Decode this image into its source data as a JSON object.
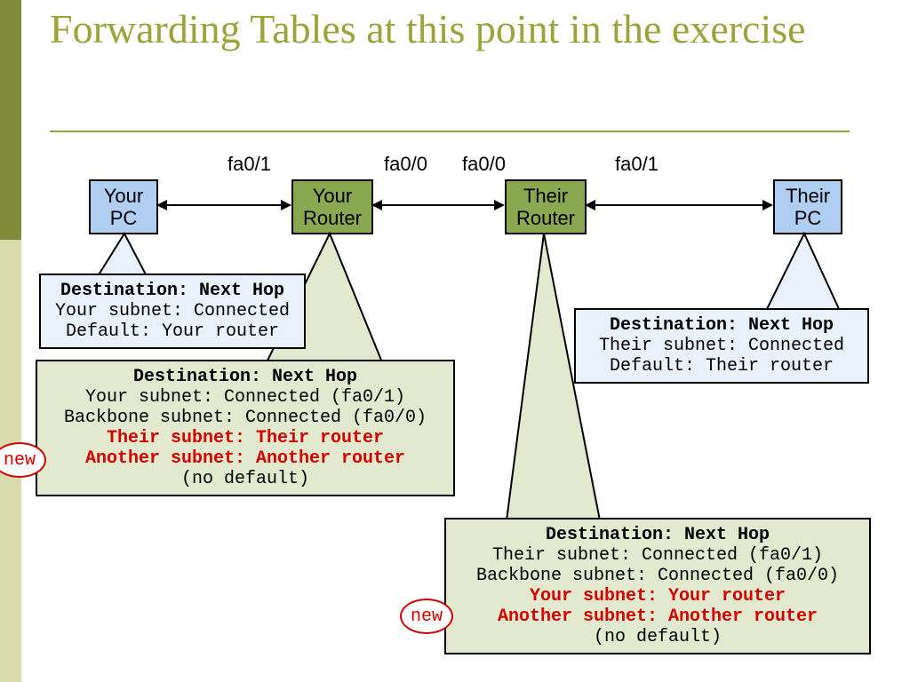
{
  "title": "Forwarding Tables at this point in the exercise",
  "iface": {
    "a": "fa0/1",
    "b": "fa0/0",
    "c": "fa0/0",
    "d": "fa0/1"
  },
  "nodes": {
    "yourpc": {
      "l1": "Your",
      "l2": "PC"
    },
    "yourrouter": {
      "l1": "Your",
      "l2": "Router"
    },
    "theirrouter": {
      "l1": "Their",
      "l2": "Router"
    },
    "theirpc": {
      "l1": "Their",
      "l2": "PC"
    }
  },
  "callouts": {
    "yourpc": {
      "head": "Destination: Next Hop",
      "r1": "Your subnet: Connected",
      "r2": "Default: Your router"
    },
    "theirpc": {
      "head": "Destination: Next Hop",
      "r1": "Their subnet: Connected",
      "r2": "Default: Their router"
    },
    "yourrouter": {
      "head": "Destination: Next Hop",
      "r1": "Your subnet: Connected (fa0/1)",
      "r2": "Backbone subnet: Connected (fa0/0)",
      "r3": "Their subnet: Their router",
      "r4": "Another subnet: Another router",
      "r5": "(no default)"
    },
    "theirrouter": {
      "head": "Destination: Next Hop",
      "r1": "Their subnet: Connected (fa0/1)",
      "r2": "Backbone subnet: Connected (fa0/0)",
      "r3": "Your subnet: Your router",
      "r4": "Another subnet: Another router",
      "r5": "(no default)"
    }
  },
  "badge": "new"
}
